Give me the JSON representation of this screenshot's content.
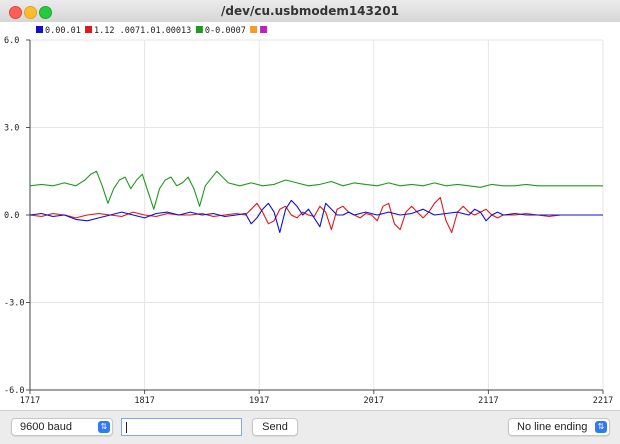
{
  "window": {
    "title": "/dev/cu.usbmodem143201"
  },
  "legend": [
    {
      "label": "0.00.01",
      "color": "#1010cc"
    },
    {
      "label": "1.12 .0071.01.00013",
      "color": "#dd1a1a"
    },
    {
      "label": "0-0.0007",
      "color": "#1f9a1f"
    },
    {
      "label": "",
      "color": "#f0a020"
    },
    {
      "label": "",
      "color": "#c020c0"
    }
  ],
  "chart_data": {
    "type": "line",
    "ylim": [
      -6.0,
      6.0
    ],
    "yticks": [
      "6.0",
      "3.0",
      "0.0",
      "-3.0",
      "-6.0"
    ],
    "xlim": [
      1717,
      2217
    ],
    "xticks": [
      "1717",
      "1817",
      "1917",
      "2017",
      "2117",
      "2217"
    ],
    "grid": true,
    "series": [
      {
        "color": "#1f9a1f",
        "x": [
          1717,
          1727,
          1737,
          1747,
          1757,
          1765,
          1770,
          1775,
          1780,
          1785,
          1790,
          1795,
          1800,
          1805,
          1810,
          1815,
          1820,
          1825,
          1830,
          1835,
          1840,
          1845,
          1850,
          1855,
          1860,
          1865,
          1870,
          1880,
          1890,
          1900,
          1910,
          1920,
          1930,
          1940,
          1950,
          1960,
          1970,
          1980,
          1990,
          2000,
          2010,
          2020,
          2030,
          2040,
          2050,
          2060,
          2070,
          2080,
          2090,
          2100,
          2110,
          2120,
          2130,
          2140,
          2150,
          2160,
          2170,
          2180,
          2190,
          2200,
          2210,
          2217
        ],
        "y": [
          1.0,
          1.05,
          1.0,
          1.1,
          1.0,
          1.2,
          1.4,
          1.5,
          1.0,
          0.4,
          0.9,
          1.2,
          1.3,
          0.9,
          1.2,
          1.4,
          0.8,
          0.2,
          0.9,
          1.2,
          1.3,
          1.0,
          1.1,
          1.3,
          0.9,
          0.3,
          1.0,
          1.5,
          1.1,
          1.0,
          1.1,
          1.0,
          1.05,
          1.2,
          1.1,
          1.0,
          1.05,
          1.15,
          1.0,
          1.1,
          1.05,
          1.0,
          1.1,
          1.0,
          1.05,
          1.0,
          1.1,
          1.0,
          1.05,
          1.0,
          0.95,
          1.05,
          1.0,
          1.0,
          1.05,
          1.0,
          1.0,
          1.0,
          1.0,
          1.0,
          1.0,
          1.0
        ]
      },
      {
        "color": "#dd1a1a",
        "x": [
          1717,
          1727,
          1737,
          1747,
          1757,
          1767,
          1777,
          1787,
          1797,
          1807,
          1817,
          1827,
          1837,
          1847,
          1857,
          1867,
          1877,
          1887,
          1897,
          1905,
          1910,
          1915,
          1920,
          1925,
          1930,
          1935,
          1940,
          1945,
          1950,
          1955,
          1960,
          1965,
          1970,
          1975,
          1980,
          1985,
          1990,
          1995,
          2000,
          2005,
          2010,
          2015,
          2020,
          2025,
          2030,
          2035,
          2040,
          2045,
          2050,
          2055,
          2060,
          2065,
          2070,
          2075,
          2080,
          2085,
          2090,
          2095,
          2100,
          2105,
          2110,
          2115,
          2120,
          2125,
          2130,
          2140,
          2150,
          2160,
          2170,
          2180,
          2190,
          2200,
          2210,
          2217
        ],
        "y": [
          0.0,
          -0.05,
          0.05,
          0.0,
          -0.1,
          0.0,
          0.05,
          0.0,
          -0.05,
          0.1,
          0.0,
          -0.05,
          0.05,
          0.0,
          0.0,
          0.05,
          -0.05,
          0.0,
          0.05,
          0.0,
          0.2,
          0.4,
          0.1,
          -0.3,
          -0.2,
          0.2,
          0.3,
          0.0,
          -0.1,
          0.1,
          0.0,
          -0.05,
          0.3,
          0.1,
          -0.5,
          0.2,
          0.3,
          0.1,
          0.0,
          -0.1,
          0.05,
          0.0,
          -0.2,
          0.3,
          0.4,
          -0.3,
          -0.5,
          0.1,
          0.3,
          0.1,
          -0.1,
          0.1,
          0.4,
          0.6,
          -0.2,
          -0.6,
          0.1,
          0.3,
          0.1,
          0.0,
          0.1,
          0.2,
          0.0,
          -0.1,
          0.0,
          0.0,
          0.05,
          0.0,
          -0.05,
          0.0,
          0.0,
          0.0,
          0.0,
          0.0
        ]
      },
      {
        "color": "#1010cc",
        "x": [
          1717,
          1727,
          1737,
          1747,
          1757,
          1767,
          1777,
          1787,
          1797,
          1807,
          1817,
          1827,
          1837,
          1847,
          1857,
          1867,
          1877,
          1887,
          1897,
          1905,
          1910,
          1915,
          1920,
          1925,
          1930,
          1935,
          1940,
          1945,
          1950,
          1955,
          1960,
          1965,
          1970,
          1975,
          1980,
          1985,
          1990,
          1995,
          2000,
          2005,
          2010,
          2020,
          2030,
          2040,
          2050,
          2060,
          2070,
          2080,
          2090,
          2100,
          2105,
          2110,
          2115,
          2120,
          2125,
          2130,
          2140,
          2150,
          2160,
          2170,
          2180,
          2190,
          2200,
          2210,
          2217
        ],
        "y": [
          0.0,
          0.05,
          -0.05,
          0.0,
          -0.15,
          -0.2,
          -0.1,
          0.0,
          0.1,
          0.0,
          -0.1,
          0.05,
          0.1,
          0.0,
          0.1,
          0.0,
          0.05,
          -0.05,
          0.0,
          0.05,
          -0.3,
          -0.1,
          0.2,
          0.4,
          0.1,
          -0.6,
          0.2,
          0.5,
          0.3,
          0.0,
          0.2,
          -0.1,
          -0.4,
          0.4,
          0.2,
          0.0,
          0.0,
          0.1,
          0.0,
          0.05,
          0.1,
          0.0,
          0.1,
          0.0,
          0.05,
          0.2,
          0.0,
          0.05,
          0.1,
          0.0,
          0.2,
          0.1,
          -0.2,
          0.0,
          0.1,
          0.0,
          0.05,
          0.0,
          0.0,
          0.0,
          0.0,
          0.0,
          0.0,
          0.0,
          0.0
        ]
      }
    ]
  },
  "bottom": {
    "baud": "9600 baud",
    "input_value": "",
    "send_label": "Send",
    "line_ending": "No line ending",
    "chevron": "⇅"
  }
}
